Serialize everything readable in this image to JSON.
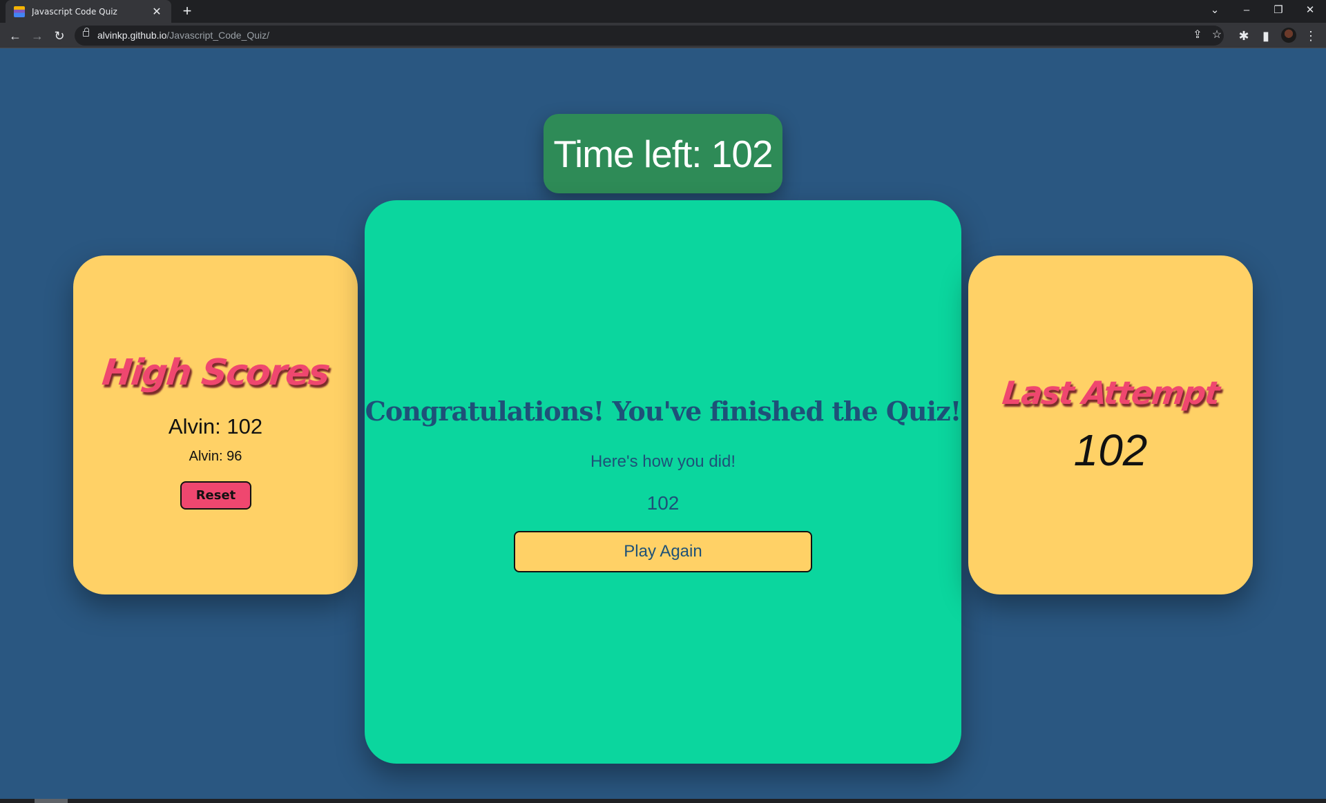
{
  "browser": {
    "tab_title": "Javascript Code Quiz",
    "tab_close": "✕",
    "new_tab": "+",
    "url_host": "alvinkp.github.io",
    "url_path": "/Javascript_Code_Quiz/",
    "icons": {
      "back": "←",
      "forward": "→",
      "reload": "↻",
      "share": "⇪",
      "star": "☆",
      "extensions": "✱",
      "sidepanel": "▮",
      "menu": "⋮",
      "tab_search": "⌄",
      "minimize": "–",
      "restore": "❐",
      "close": "✕"
    }
  },
  "quiz": {
    "timer_text": "Time left: 102",
    "high_scores": {
      "title": "High Scores",
      "entries": [
        "Alvin: 102",
        "Alvin: 96"
      ],
      "reset_label": "Reset"
    },
    "result": {
      "heading": "Congratulations! You've finished the Quiz!",
      "subtext": "Here's how you did!",
      "score": "102",
      "play_again_label": "Play Again"
    },
    "last_attempt": {
      "title": "Last Attempt",
      "score": "102"
    }
  },
  "colors": {
    "page_bg": "#2a5781",
    "timer_bg": "#2e8b57",
    "main_card_bg": "#0bd69e",
    "side_card_bg": "#ffd166",
    "accent_pink": "#ef476f",
    "text_blue": "#1e5178"
  }
}
